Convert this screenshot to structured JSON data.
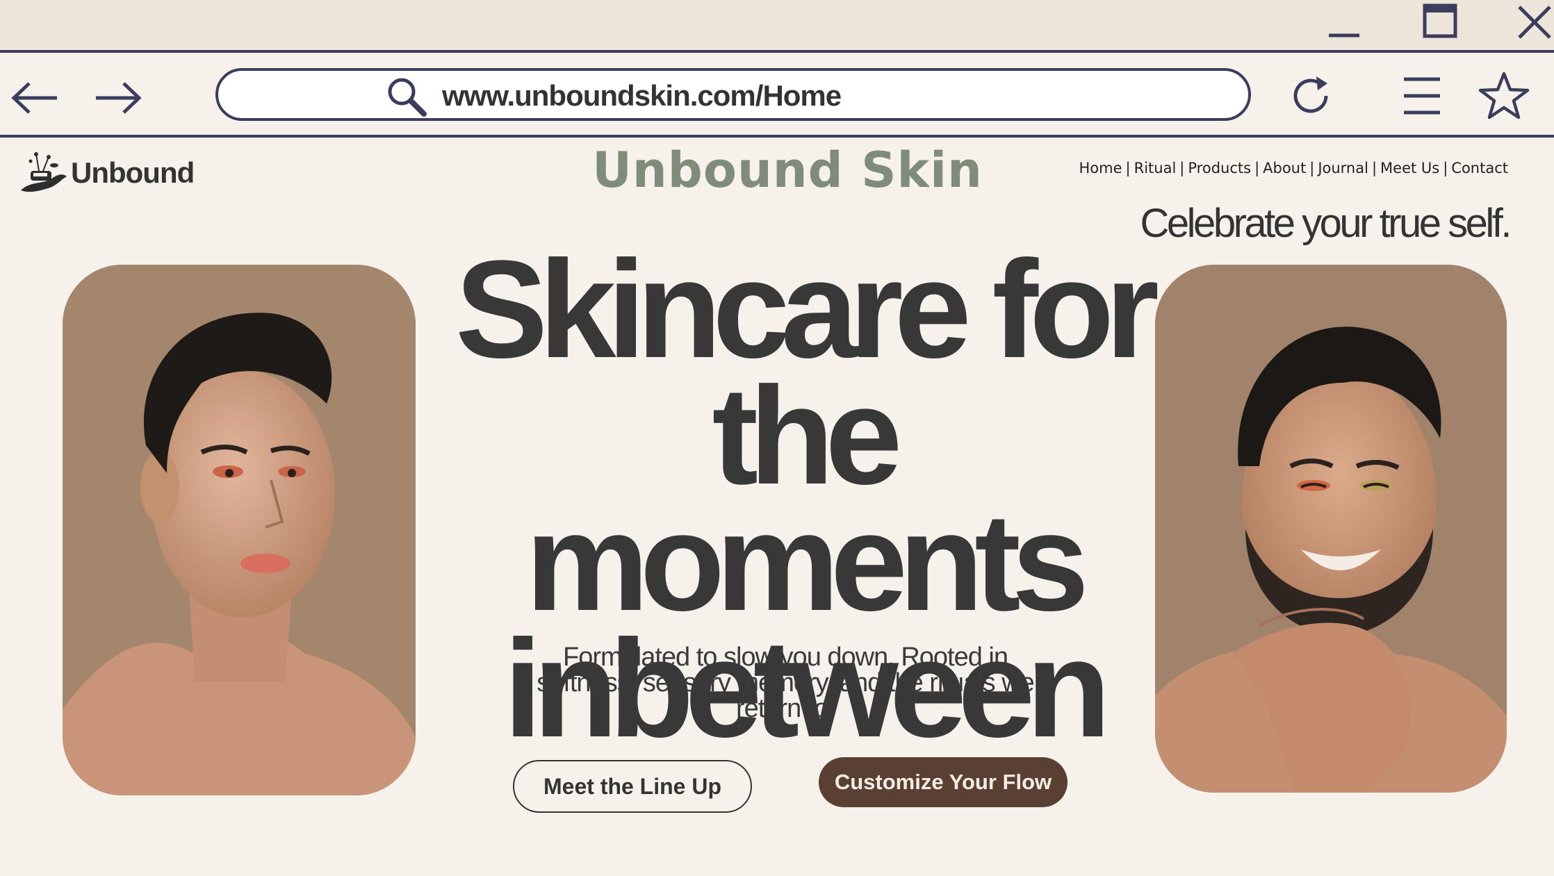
{
  "browser": {
    "url": "www.unboundskin.com/Home",
    "window_controls": [
      "minimize-icon",
      "maximize-icon",
      "close-icon"
    ],
    "nav_icons": [
      "back-arrow-icon",
      "forward-arrow-icon"
    ],
    "toolbar_icons": [
      "search-icon",
      "reload-icon",
      "menu-icon",
      "star-icon"
    ],
    "chrome_color": "#3b3d5c"
  },
  "site": {
    "brand_name": "Unbound",
    "title": "Unbound Skin",
    "nav": [
      {
        "label": "Home"
      },
      {
        "label": "Ritual"
      },
      {
        "label": "Products"
      },
      {
        "label": "About"
      },
      {
        "label": "Journal"
      },
      {
        "label": "Meet Us"
      },
      {
        "label": "Contact"
      }
    ],
    "nav_separator": "|",
    "tagline": "Celebrate your true self."
  },
  "hero": {
    "headline_lines": [
      "Skincare for",
      "the moments",
      "inbetween"
    ],
    "subcopy": "Formulated to slow you down. Rooted in softness, sensory memory, and the rituals we return to.",
    "primary_button": "Meet the Line Up",
    "secondary_button": "Customize Your Flow",
    "accent_color": "#5a3f33",
    "title_color": "#7f8c79",
    "background_color": "#f6f1eb"
  }
}
